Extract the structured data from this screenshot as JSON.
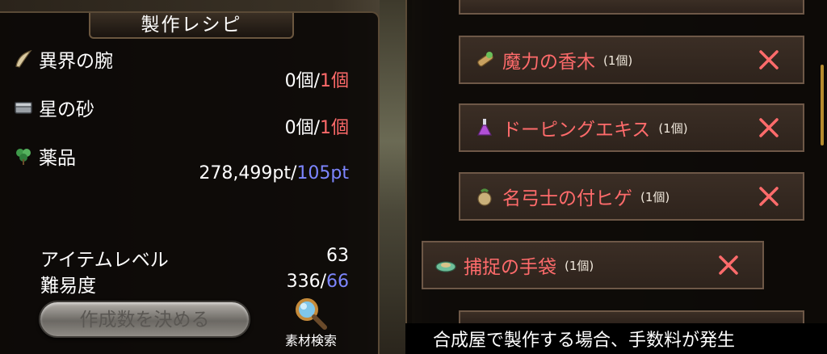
{
  "left": {
    "title": "製作レシピ",
    "materials": [
      {
        "name": "異界の腕",
        "have": "0個/",
        "need": "1個",
        "icon": "horn-icon"
      },
      {
        "name": "星の砂",
        "have": "0個/",
        "need": "1個",
        "icon": "sand-chest-icon"
      },
      {
        "name": "薬品",
        "have": "278,499pt/",
        "need": "105pt",
        "icon": "herb-icon"
      }
    ],
    "item_level_label": "アイテムレベル",
    "item_level_value": "63",
    "difficulty_label": "難易度",
    "difficulty_have": "336/",
    "difficulty_need": "66",
    "decide_button": "作成数を決める",
    "search_label": "素材検索"
  },
  "right": {
    "items": [
      {
        "name": "魔力の香木",
        "qty": "(1個)",
        "icon": "wood-icon"
      },
      {
        "name": "ドーピングエキス",
        "qty": "(1個)",
        "icon": "potion-icon"
      },
      {
        "name": "名弓士の付ヒゲ",
        "qty": "(1個)",
        "icon": "pouch-icon"
      },
      {
        "name": "捕捉の手袋",
        "qty": "(1個)",
        "icon": "glove-icon"
      }
    ],
    "bottom_message": "合成屋で製作する場合、手数料が発生"
  },
  "colors": {
    "required_red": "#ff6a6a",
    "required_blue": "#7d86ff",
    "item_name": "#ff6b6b",
    "remove_x": "#ff6b6b"
  }
}
